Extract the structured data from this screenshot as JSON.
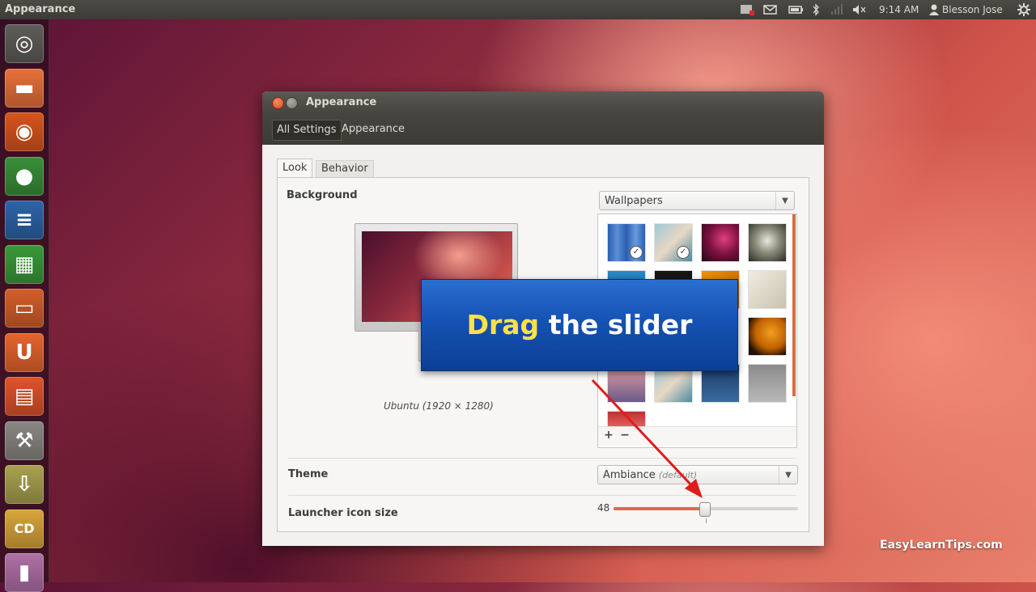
{
  "top_panel": {
    "app_title": "Appearance",
    "time": "9:14 AM",
    "user": "Blesson Jose",
    "indicators": [
      "keyboard-indicator",
      "mail-icon",
      "battery-icon",
      "bluetooth-icon",
      "network-icon",
      "volume-icon"
    ]
  },
  "launcher": {
    "items": [
      {
        "name": "dash-home",
        "color": "#5e5d59",
        "glyph": "◎"
      },
      {
        "name": "files",
        "color": "#e8713a",
        "glyph": "▬"
      },
      {
        "name": "firefox",
        "color": "#d9541d",
        "glyph": "◉"
      },
      {
        "name": "chrome",
        "color": "#3a8f3a",
        "glyph": "●"
      },
      {
        "name": "libreoffice-writer",
        "color": "#2e64a8",
        "glyph": "≡"
      },
      {
        "name": "libreoffice-calc",
        "color": "#3a9a3a",
        "glyph": "▦"
      },
      {
        "name": "libreoffice-impress",
        "color": "#d35f2a",
        "glyph": "▭"
      },
      {
        "name": "ubuntu-software-center",
        "color": "#e6642d",
        "glyph": "U"
      },
      {
        "name": "ubuntu-one",
        "color": "#e0532b",
        "glyph": "▤"
      },
      {
        "name": "system-settings",
        "color": "#8a8884",
        "glyph": "⚒"
      },
      {
        "name": "downloads",
        "color": "#a9a250",
        "glyph": "⇩"
      },
      {
        "name": "cd-drive",
        "color": "#d9a53a",
        "glyph": "CD"
      },
      {
        "name": "trash",
        "color": "#b070a8",
        "glyph": "▮"
      }
    ]
  },
  "window": {
    "title": "Appearance",
    "breadcrumbs": [
      "All Settings",
      "Appearance"
    ],
    "tabs": [
      "Look",
      "Behavior"
    ],
    "background_label": "Background",
    "wallpaper_source": "Wallpapers",
    "preview_caption": "Ubuntu (1920 × 1280)",
    "add_button": "+",
    "remove_button": "−",
    "theme_label": "Theme",
    "theme_value": "Ambiance",
    "theme_hint": "(default)",
    "launcher_label": "Launcher icon size",
    "launcher_value": "48",
    "slider_fraction": 0.49
  },
  "overlay": {
    "word1": "Drag",
    "word2": "the slider",
    "highlight_color": "#ffe24a",
    "arrow_color": "#e01b1b"
  },
  "watermark": "EasyLearnTips.com",
  "colors": {
    "accent": "#dd4814",
    "slider": "#e1694a",
    "panel": "#3c3b37"
  }
}
